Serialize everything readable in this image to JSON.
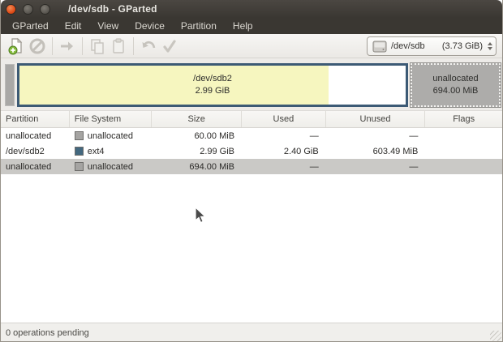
{
  "window": {
    "title": "/dev/sdb - GParted"
  },
  "menu": {
    "items": [
      "GParted",
      "Edit",
      "View",
      "Device",
      "Partition",
      "Help"
    ]
  },
  "toolbar": {
    "buttons": [
      "new",
      "delete",
      "resize-move",
      "copy",
      "paste",
      "undo",
      "apply"
    ],
    "device_selector": {
      "device": "/dev/sdb",
      "size": "(3.73 GiB)"
    }
  },
  "graphic_bar": {
    "partition": {
      "name": "/dev/sdb2",
      "size": "2.99 GiB"
    },
    "unallocated": {
      "label": "unallocated",
      "size": "694.00 MiB"
    }
  },
  "table": {
    "headers": [
      "Partition",
      "File System",
      "Size",
      "Used",
      "Unused",
      "Flags"
    ],
    "rows": [
      {
        "partition": "unallocated",
        "filesystem": "unallocated",
        "size": "60.00 MiB",
        "used": "—",
        "unused": "—",
        "flags": ""
      },
      {
        "partition": "/dev/sdb2",
        "filesystem": "ext4",
        "size": "2.99 GiB",
        "used": "2.40 GiB",
        "unused": "603.49 MiB",
        "flags": ""
      },
      {
        "partition": "unallocated",
        "filesystem": "unallocated",
        "size": "694.00 MiB",
        "used": "—",
        "unused": "—",
        "flags": ""
      }
    ]
  },
  "statusbar": {
    "text": "0 operations pending"
  },
  "colors": {
    "titlebar_bg": "#3a3732",
    "close_button": "#dd4814",
    "partition_border": "#3c5a75",
    "used_fill": "#f6f6bf",
    "unused_fill": "#ffffff",
    "unallocated_fill": "#adacaa",
    "ext4_swatch": "#43687f",
    "unallocated_swatch": "#a5a4a2",
    "selected_row_bg": "#cac9c6"
  }
}
